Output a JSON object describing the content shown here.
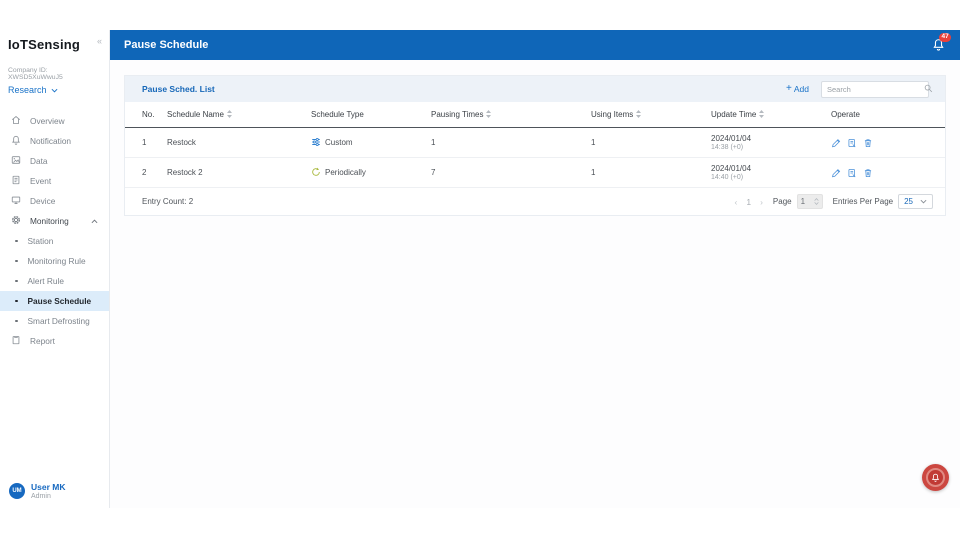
{
  "colors": {
    "topbar_blue": "#0f66b8",
    "accent_blue": "#1a73c8",
    "badge_red": "#e8413c",
    "active_item_bg": "#dcecfa",
    "custom_icon_blue": "#2f80d0",
    "periodic_icon_green": "#a9b93e",
    "operate_icon_blue": "#4a90d9",
    "fab_red": "#cc4740"
  },
  "sidebar": {
    "brand": "IoTSensing",
    "collapse_glyph": "«",
    "company_id": "Company ID: XWSD5XuWwuJ5",
    "team": "Research",
    "items": [
      {
        "label": "Overview",
        "icon": "home-icon"
      },
      {
        "label": "Notification",
        "icon": "bell-icon"
      },
      {
        "label": "Data",
        "icon": "data-icon"
      },
      {
        "label": "Event",
        "icon": "event-icon"
      },
      {
        "label": "Device",
        "icon": "device-icon"
      },
      {
        "label": "Monitoring",
        "icon": "gear-icon",
        "expanded": true
      }
    ],
    "monitoring_children": [
      {
        "label": "Station"
      },
      {
        "label": "Monitoring Rule"
      },
      {
        "label": "Alert Rule"
      },
      {
        "label": "Pause Schedule",
        "active": true
      },
      {
        "label": "Smart Defrosting"
      }
    ],
    "report_label": "Report",
    "user": {
      "initials": "UM",
      "name": "User MK",
      "role": "Admin"
    }
  },
  "header": {
    "title": "Pause Schedule",
    "notification_count": "47"
  },
  "card": {
    "title": "Pause Sched. List",
    "add_glyph": "+",
    "add_label": "Add",
    "search_placeholder": "Search"
  },
  "table": {
    "columns": [
      "No.",
      "Schedule Name",
      "Schedule Type",
      "Pausing Times",
      "Using Items",
      "Update Time",
      "Operate"
    ],
    "rows": [
      {
        "no": "1",
        "name": "Restock",
        "type": "Custom",
        "pausing_times": "1",
        "using_items": "1",
        "update_date": "2024/01/04",
        "update_time": "14:38 (+0)"
      },
      {
        "no": "2",
        "name": "Restock 2",
        "type": "Periodically",
        "pausing_times": "7",
        "using_items": "1",
        "update_date": "2024/01/04",
        "update_time": "14:40 (+0)"
      }
    ]
  },
  "footer": {
    "entry_count": "Entry Count: 2",
    "prev_glyph": "‹",
    "current_page": "1",
    "next_glyph": "›",
    "page_label": "Page",
    "page_input_value": "1",
    "per_page_label": "Entries Per Page",
    "per_page_value": "25"
  }
}
